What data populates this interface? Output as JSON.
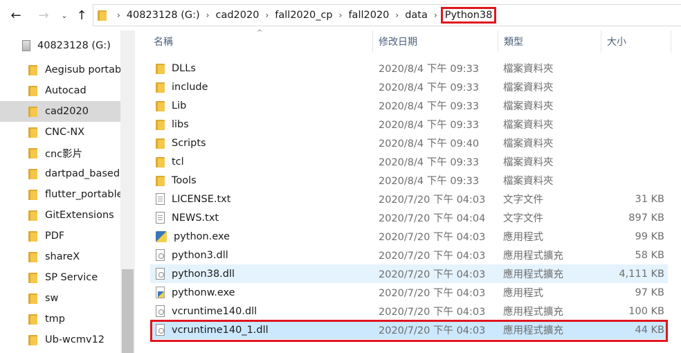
{
  "nav": {
    "back_icon": "←",
    "forward_icon": "→",
    "recent_icon": "⌄",
    "up_icon": "↑"
  },
  "breadcrumb": {
    "separator": "›",
    "items": [
      "40823128 (G:)",
      "cad2020",
      "fall2020_cp",
      "fall2020",
      "data"
    ],
    "current": "Python38"
  },
  "sidebar": {
    "drive_label": "40823128 (G:)",
    "items": [
      {
        "label": "Aegisub portable"
      },
      {
        "label": "Autocad"
      },
      {
        "label": "cad2020"
      },
      {
        "label": "CNC-NX"
      },
      {
        "label": "cnc影片"
      },
      {
        "label": "dartpad_based"
      },
      {
        "label": "flutter_portable"
      },
      {
        "label": "GitExtensions"
      },
      {
        "label": "PDF"
      },
      {
        "label": "shareX"
      },
      {
        "label": "SP Service"
      },
      {
        "label": "sw"
      },
      {
        "label": "tmp"
      },
      {
        "label": "Ub-wcmv12"
      }
    ],
    "selected_index": 2
  },
  "columns": {
    "name": "名稱",
    "date": "修改日期",
    "type": "類型",
    "size": "大小",
    "sort_caret": "^"
  },
  "files": [
    {
      "name": "DLLs",
      "date": "2020/8/4 下午 09:33",
      "type": "檔案資料夾",
      "size": "",
      "icon": "folder-icon"
    },
    {
      "name": "include",
      "date": "2020/8/4 下午 09:33",
      "type": "檔案資料夾",
      "size": "",
      "icon": "folder-icon"
    },
    {
      "name": "Lib",
      "date": "2020/8/4 下午 09:33",
      "type": "檔案資料夾",
      "size": "",
      "icon": "folder-icon"
    },
    {
      "name": "libs",
      "date": "2020/8/4 下午 09:33",
      "type": "檔案資料夾",
      "size": "",
      "icon": "folder-icon"
    },
    {
      "name": "Scripts",
      "date": "2020/8/4 下午 09:40",
      "type": "檔案資料夾",
      "size": "",
      "icon": "folder-icon"
    },
    {
      "name": "tcl",
      "date": "2020/8/4 下午 09:33",
      "type": "檔案資料夾",
      "size": "",
      "icon": "folder-icon"
    },
    {
      "name": "Tools",
      "date": "2020/8/4 下午 09:33",
      "type": "檔案資料夾",
      "size": "",
      "icon": "folder-icon"
    },
    {
      "name": "LICENSE.txt",
      "date": "2020/7/20 下午 04:03",
      "type": "文字文件",
      "size": "31 KB",
      "icon": "text-file-icon"
    },
    {
      "name": "NEWS.txt",
      "date": "2020/7/20 下午 04:04",
      "type": "文字文件",
      "size": "897 KB",
      "icon": "text-file-icon"
    },
    {
      "name": "python.exe",
      "date": "2020/7/20 下午 04:03",
      "type": "應用程式",
      "size": "99 KB",
      "icon": "python-exe-icon"
    },
    {
      "name": "python3.dll",
      "date": "2020/7/20 下午 04:03",
      "type": "應用程式擴充",
      "size": "58 KB",
      "icon": "dll-file-icon"
    },
    {
      "name": "python38.dll",
      "date": "2020/7/20 下午 04:03",
      "type": "應用程式擴充",
      "size": "4,111 KB",
      "icon": "dll-file-icon"
    },
    {
      "name": "pythonw.exe",
      "date": "2020/7/20 下午 04:03",
      "type": "應用程式",
      "size": "97 KB",
      "icon": "pythonw-exe-icon"
    },
    {
      "name": "vcruntime140.dll",
      "date": "2020/7/20 下午 04:03",
      "type": "應用程式擴充",
      "size": "100 KB",
      "icon": "dll-file-icon"
    },
    {
      "name": "vcruntime140_1.dll",
      "date": "2020/7/20 下午 04:03",
      "type": "應用程式擴充",
      "size": "44 KB",
      "icon": "dll-file-icon"
    }
  ],
  "hover_index": 11,
  "selected_index": 14,
  "colors": {
    "highlight": "#e0161e",
    "row_selected": "#cce8ff",
    "row_hover": "#e5f3ff",
    "header_text": "#4c607a"
  }
}
